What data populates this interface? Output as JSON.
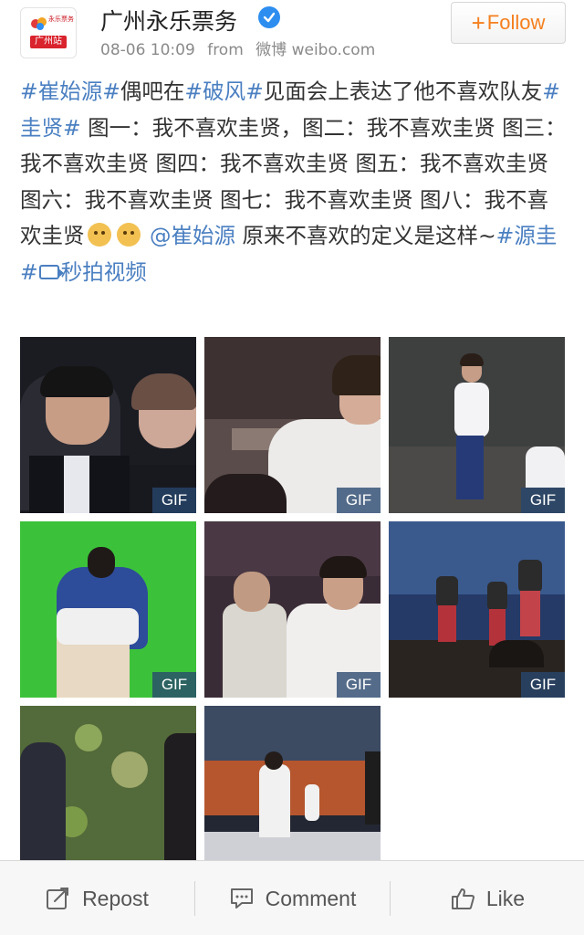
{
  "header": {
    "avatar_badge": "广州站",
    "avatar_top_text": "永乐票务",
    "username": "广州永乐票务",
    "timestamp": "08-06 10:09",
    "from_label": "from",
    "source": "微博 weibo.com",
    "follow_label": "Follow",
    "follow_plus": "+"
  },
  "post": {
    "segments": [
      {
        "text": "#崔始源#",
        "tag": true
      },
      {
        "text": "偶吧在",
        "tag": false
      },
      {
        "text": "#破风#",
        "tag": true
      },
      {
        "text": "见面会上表达了他不喜欢队友",
        "tag": false
      },
      {
        "text": "#圭贤#",
        "tag": true
      },
      {
        "text": " 图一：我不喜欢圭贤，图二：我不喜欢圭贤 图三：我不喜欢圭贤 图四：我不喜欢圭贤 图五：我不喜欢圭贤 图六：我不喜欢圭贤 图七：我不喜欢圭贤 图八：我不喜欢圭贤",
        "tag": false
      }
    ],
    "mention": "@崔始源",
    "tail_text": " 原来不喜欢的定义是这样~",
    "tag_end": "#源圭#",
    "video_label": "秒拍视频"
  },
  "grid": {
    "gif_label": "GIF",
    "thumbnails": [
      {
        "gif": true
      },
      {
        "gif": true
      },
      {
        "gif": true
      },
      {
        "gif": true
      },
      {
        "gif": true
      },
      {
        "gif": true
      },
      {
        "gif": false
      },
      {
        "gif": false
      }
    ]
  },
  "actions": {
    "repost": "Repost",
    "comment": "Comment",
    "like": "Like"
  },
  "colors": {
    "link": "#4a7fc1",
    "follow": "#f57f1e",
    "verified": "#2d8ef0",
    "gif_badge": "#28466e"
  }
}
